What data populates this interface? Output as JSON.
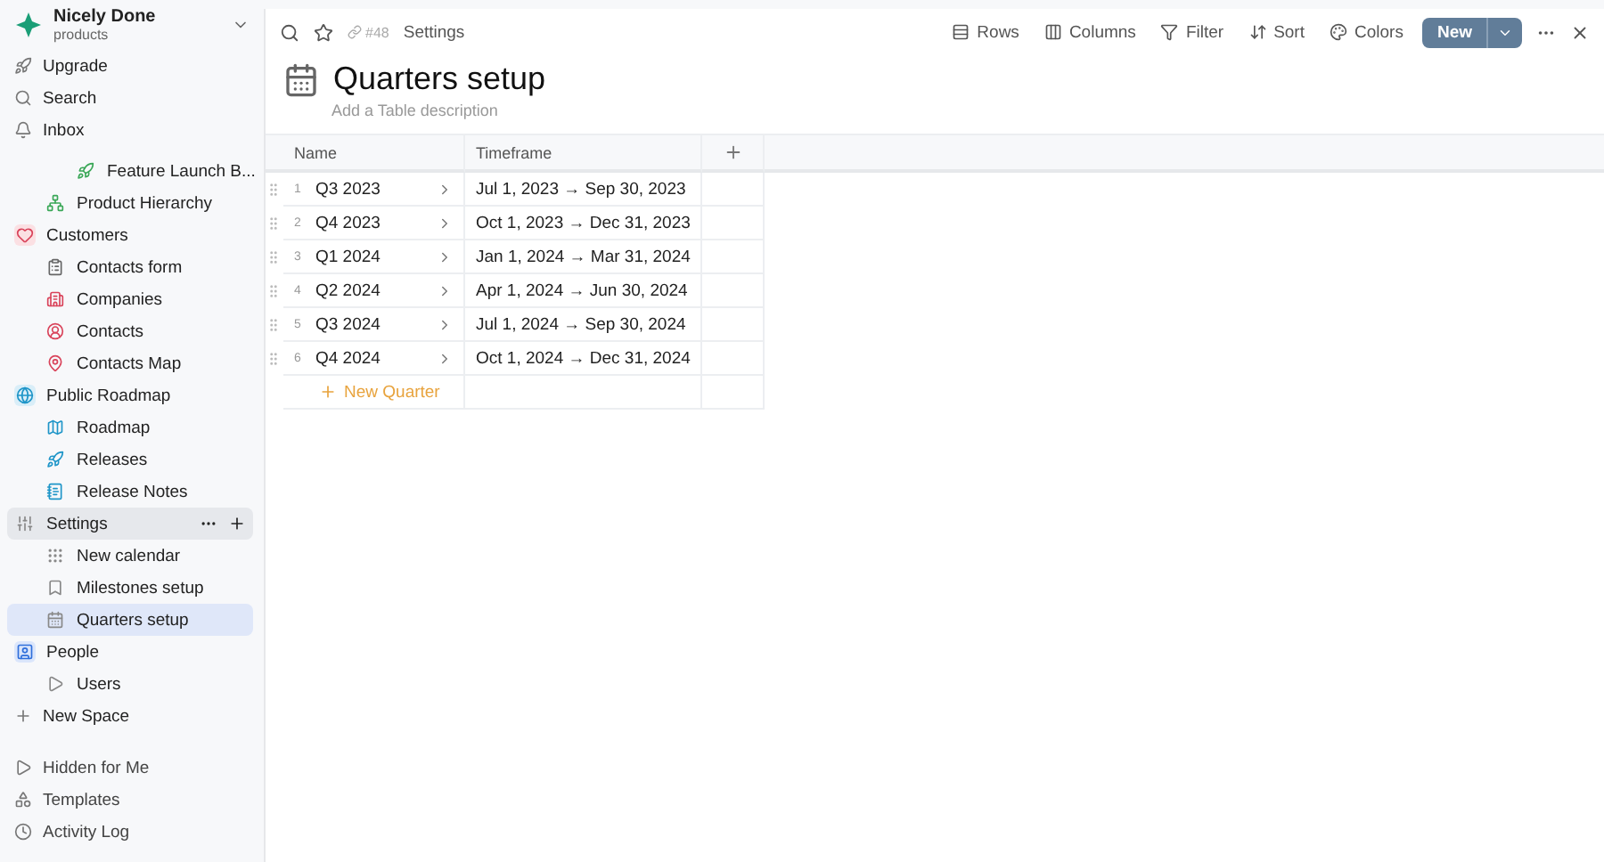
{
  "workspace": {
    "name": "Nicely Done",
    "subtitle": "products"
  },
  "nav": [
    {
      "label": "Upgrade"
    },
    {
      "label": "Search"
    },
    {
      "label": "Inbox"
    }
  ],
  "tree": [
    {
      "children": [
        {
          "children": [
            {
              "label": "Feature Launch B...",
              "selected": false,
              "show_actions": false
            }
          ]
        },
        {
          "label": "Product Hierarchy",
          "selected": false,
          "show_actions": false
        }
      ]
    },
    {
      "label": "Customers",
      "selected": false,
      "show_actions": false,
      "children": [
        {
          "label": "Contacts form",
          "selected": false,
          "show_actions": false
        },
        {
          "label": "Companies",
          "selected": false,
          "show_actions": false
        },
        {
          "label": "Contacts",
          "selected": false,
          "show_actions": false
        },
        {
          "label": "Contacts Map",
          "selected": false,
          "show_actions": false
        }
      ]
    },
    {
      "label": "Public Roadmap",
      "selected": false,
      "show_actions": false,
      "children": [
        {
          "label": "Roadmap",
          "selected": false,
          "show_actions": false
        },
        {
          "label": "Releases",
          "selected": false,
          "show_actions": false
        },
        {
          "label": "Release Notes",
          "selected": false,
          "show_actions": false
        }
      ]
    },
    {
      "label": "Settings",
      "selected": false,
      "show_actions": true,
      "children": [
        {
          "label": "New calendar",
          "selected": false,
          "show_actions": false
        },
        {
          "label": "Milestones setup",
          "selected": false,
          "show_actions": false
        },
        {
          "label": "Quarters setup",
          "selected": true,
          "show_actions": false
        }
      ]
    },
    {
      "label": "People",
      "selected": false,
      "show_actions": false,
      "children": [
        {
          "label": "Users",
          "selected": false,
          "show_actions": false
        }
      ]
    }
  ],
  "new_space": "New Space",
  "footer": [
    {
      "label": "Hidden for Me"
    },
    {
      "label": "Templates"
    },
    {
      "label": "Activity Log"
    }
  ],
  "toolbar": {
    "ref": "#48",
    "breadcrumb": "Settings",
    "actions": [
      {
        "label": "Rows"
      },
      {
        "label": "Columns"
      },
      {
        "label": "Filter"
      },
      {
        "label": "Sort"
      },
      {
        "label": "Colors"
      }
    ],
    "new_button": "New"
  },
  "page": {
    "title": "Quarters setup",
    "description_placeholder": "Add a Table description"
  },
  "table": {
    "columns": [
      "Name",
      "Timeframe"
    ],
    "rows": [
      {
        "number": "1",
        "name": "Q3 2023",
        "timeframe": "Jul 1, 2023 → Sep 30, 2023"
      },
      {
        "number": "2",
        "name": "Q4 2023",
        "timeframe": "Oct 1, 2023 → Dec 31, 2023"
      },
      {
        "number": "3",
        "name": "Q1 2024",
        "timeframe": "Jan 1, 2024 → Mar 31, 2024"
      },
      {
        "number": "4",
        "name": "Q2 2024",
        "timeframe": "Apr 1, 2024 → Jun 30, 2024"
      },
      {
        "number": "5",
        "name": "Q3 2024",
        "timeframe": "Jul 1, 2024 → Sep 30, 2024"
      },
      {
        "number": "6",
        "name": "Q4 2024",
        "timeframe": "Oct 1, 2024 → Dec 31, 2024"
      }
    ],
    "new_row": "New Quarter"
  }
}
